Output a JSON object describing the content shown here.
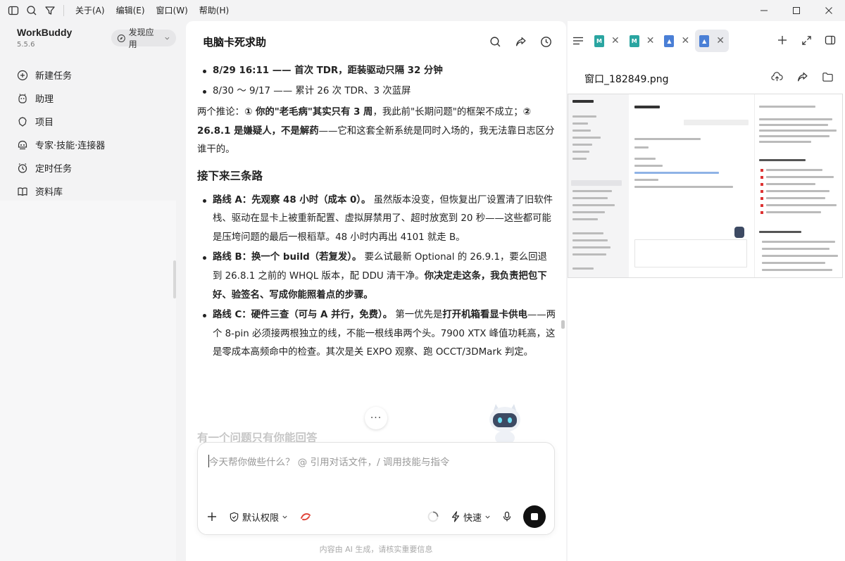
{
  "menu": {
    "items": [
      "关于(A)",
      "编辑(E)",
      "窗口(W)",
      "帮助(H)"
    ]
  },
  "sidebar": {
    "brand": "WorkBuddy",
    "version": "5.5.6",
    "discover_label": "发现应用",
    "items": [
      {
        "label": "新建任务",
        "icon": "plus-circle-icon"
      },
      {
        "label": "助理",
        "icon": "assistant-icon"
      },
      {
        "label": "项目",
        "icon": "project-icon"
      },
      {
        "label": "专家·技能·连接器",
        "icon": "expert-icon"
      },
      {
        "label": "定时任务",
        "icon": "clock-icon"
      },
      {
        "label": "资料库",
        "icon": "book-icon"
      }
    ]
  },
  "chat": {
    "title": "电脑卡死求助",
    "bullets_top": [
      {
        "bold": "8/29 16:11 —— 首次 TDR，距装驱动只隔 32 分钟",
        "rest": ""
      },
      {
        "bold": "",
        "rest": "8/30 ～ 9/17 —— 累计 26 次 TDR、3 次蓝屏"
      }
    ],
    "inference": {
      "p1": "两个推论：",
      "p2": "① 你的\"老毛病\"其实只有 3 周",
      "p3": "，我此前\"长期问题\"的框架不成立；",
      "p4": "② 26.8.1 是嫌疑人，不是解药",
      "p5": "——它和这套全新系统是同时入场的，我无法靠日志区分谁干的。"
    },
    "section_heading": "接下来三条路",
    "routes": [
      {
        "bold": "路线 A：先观察 48 小时（成本 0）。",
        "rest": " 虽然版本没变，但恢复出厂设置清了旧软件栈、驱动在显卡上被重新配置、虚拟屏禁用了、超时放宽到 20 秒——这些都可能是压垮问题的最后一根稻草。48 小时内再出 4101 就走 B。"
      },
      {
        "bold": "路线 B：换一个 build（若复发）。",
        "rest": " 要么试最新 Optional 的 26.9.1，要么回退到 26.8.1 之前的 WHQL 版本，配 DDU 清干净。",
        "bold2": "你决定走这条，我负责把包下好、验签名、写成你能照着点的步骤。"
      },
      {
        "bold": "路线 C：硬件三查（可与 A 并行，免费）。",
        "rest": " 第一优先是",
        "bold2": "打开机箱看显卡供电",
        "rest2": "——两个 8-pin 必须接两根独立的线，不能一根线串两个头。7900 XTX 峰值功耗高，这是零成本高频命中的检查。其次是关 EXPO 观察、跑 OCCT/3DMark 判定。"
      }
    ],
    "faded_heading": "有一个问题只有你能回答",
    "more_label": "···",
    "input_placeholder": "今天帮你做些什么？ @ 引用对话文件，/ 调用技能与指令",
    "permission_label": "默认权限",
    "speed_label": "快速",
    "footnote": "内容由 AI 生成，请核实重要信息"
  },
  "right_panel": {
    "tabs": [
      {
        "type": "md",
        "icon": "markdown-file-icon",
        "active": false
      },
      {
        "type": "md",
        "icon": "markdown-file-icon",
        "active": false
      },
      {
        "type": "img",
        "icon": "image-file-icon",
        "active": false
      },
      {
        "type": "img",
        "icon": "image-file-icon",
        "active": true
      }
    ],
    "filename": "窗口_182849.png"
  },
  "colors": {
    "accent_red": "#e0453a",
    "md_icon": "#2aa5a1",
    "img_icon": "#4a7fd6",
    "send_button": "#111111"
  }
}
